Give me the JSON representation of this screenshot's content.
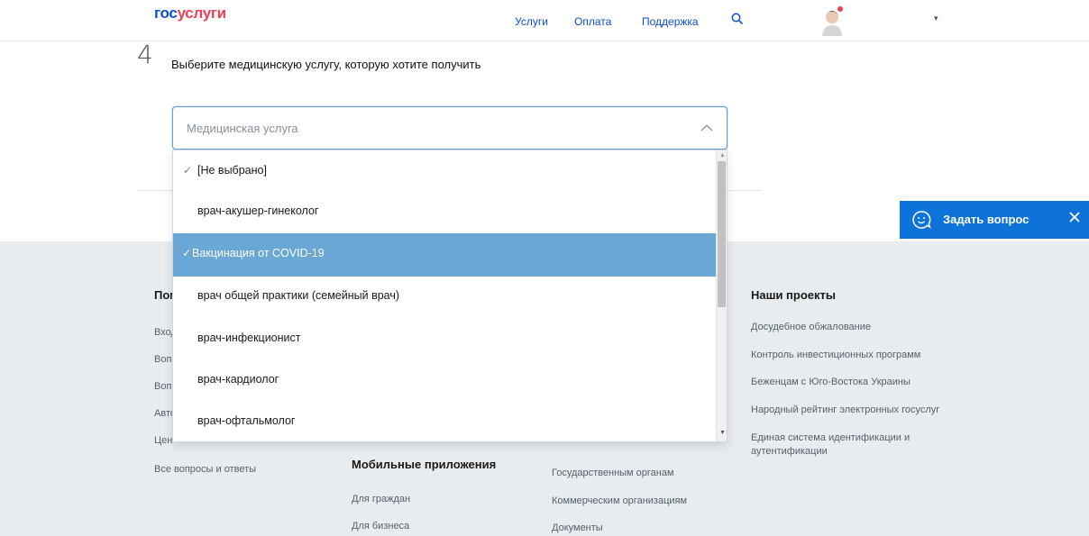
{
  "header": {
    "logo_part1": "гос",
    "logo_part2": "услуги",
    "nav": [
      "Услуги",
      "Оплата",
      "Поддержка"
    ],
    "search_icon": "search-icon",
    "avatar_icon": "user-avatar-icon",
    "menu_caret": "▾"
  },
  "step": {
    "number": "4",
    "text": "Выберите медицинскую услугу, которую хотите получить"
  },
  "select": {
    "placeholder": "Медицинская услуга",
    "chevron_icon": "chevron-up-icon",
    "options": [
      {
        "label": "[Не выбрано]",
        "check": "✓",
        "selected": false
      },
      {
        "label": "врач-акушер-гинеколог",
        "check": "",
        "selected": false
      },
      {
        "label": "Вакцинация от COVID-19",
        "check": "✓",
        "selected": true
      },
      {
        "label": "врач общей практики (семейный врач)",
        "check": "",
        "selected": false
      },
      {
        "label": "врач-инфекционист",
        "check": "",
        "selected": false
      },
      {
        "label": "врач-кардиолог",
        "check": "",
        "selected": false
      },
      {
        "label": "врач-офтальмолог",
        "check": "",
        "selected": false
      }
    ]
  },
  "chat": {
    "label": "Задать вопрос",
    "icon": "chat-smile-icon",
    "close_icon": "close-icon"
  },
  "footer": {
    "col1": {
      "heading_partial": "Пом",
      "links_partial": [
        "Вход",
        "Вопр",
        "Вопр",
        "Авто",
        "Цен"
      ],
      "last_link": "Все вопросы и ответы"
    },
    "col2": {
      "heading": "Мобильные приложения",
      "links": [
        "Для граждан",
        "Для бизнеса"
      ]
    },
    "col3": {
      "links": [
        "Государственным органам",
        "Коммерческим организациям",
        "Документы"
      ]
    },
    "col4": {
      "heading": "Наши проекты",
      "links": [
        "Досудебное обжалование",
        "Контроль инвестиционных программ",
        "Беженцам с Юго-Востока Украины",
        "Народный рейтинг электронных госуслуг",
        "Единая система идентификации и аутентификации"
      ]
    }
  },
  "colors": {
    "brand_blue": "#0d4cd3",
    "brand_red": "#ee3f58",
    "selected_option": "#6aa7d6",
    "chat_button": "#0d73d9",
    "footer_bg": "#e8ecef"
  }
}
